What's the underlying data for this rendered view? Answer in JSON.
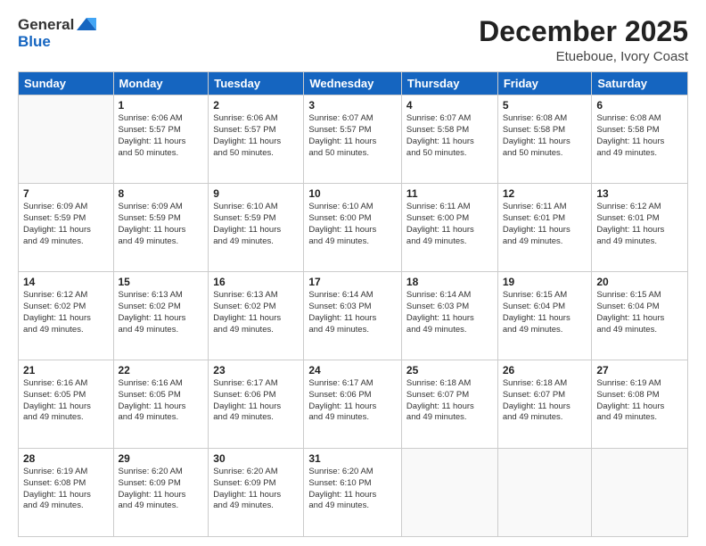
{
  "header": {
    "logo_line1": "General",
    "logo_line2": "Blue",
    "month_title": "December 2025",
    "location": "Etueboue, Ivory Coast"
  },
  "days_of_week": [
    "Sunday",
    "Monday",
    "Tuesday",
    "Wednesday",
    "Thursday",
    "Friday",
    "Saturday"
  ],
  "weeks": [
    [
      {
        "day": "",
        "info": ""
      },
      {
        "day": "1",
        "info": "Sunrise: 6:06 AM\nSunset: 5:57 PM\nDaylight: 11 hours\nand 50 minutes."
      },
      {
        "day": "2",
        "info": "Sunrise: 6:06 AM\nSunset: 5:57 PM\nDaylight: 11 hours\nand 50 minutes."
      },
      {
        "day": "3",
        "info": "Sunrise: 6:07 AM\nSunset: 5:57 PM\nDaylight: 11 hours\nand 50 minutes."
      },
      {
        "day": "4",
        "info": "Sunrise: 6:07 AM\nSunset: 5:58 PM\nDaylight: 11 hours\nand 50 minutes."
      },
      {
        "day": "5",
        "info": "Sunrise: 6:08 AM\nSunset: 5:58 PM\nDaylight: 11 hours\nand 50 minutes."
      },
      {
        "day": "6",
        "info": "Sunrise: 6:08 AM\nSunset: 5:58 PM\nDaylight: 11 hours\nand 49 minutes."
      }
    ],
    [
      {
        "day": "7",
        "info": "Sunrise: 6:09 AM\nSunset: 5:59 PM\nDaylight: 11 hours\nand 49 minutes."
      },
      {
        "day": "8",
        "info": "Sunrise: 6:09 AM\nSunset: 5:59 PM\nDaylight: 11 hours\nand 49 minutes."
      },
      {
        "day": "9",
        "info": "Sunrise: 6:10 AM\nSunset: 5:59 PM\nDaylight: 11 hours\nand 49 minutes."
      },
      {
        "day": "10",
        "info": "Sunrise: 6:10 AM\nSunset: 6:00 PM\nDaylight: 11 hours\nand 49 minutes."
      },
      {
        "day": "11",
        "info": "Sunrise: 6:11 AM\nSunset: 6:00 PM\nDaylight: 11 hours\nand 49 minutes."
      },
      {
        "day": "12",
        "info": "Sunrise: 6:11 AM\nSunset: 6:01 PM\nDaylight: 11 hours\nand 49 minutes."
      },
      {
        "day": "13",
        "info": "Sunrise: 6:12 AM\nSunset: 6:01 PM\nDaylight: 11 hours\nand 49 minutes."
      }
    ],
    [
      {
        "day": "14",
        "info": "Sunrise: 6:12 AM\nSunset: 6:02 PM\nDaylight: 11 hours\nand 49 minutes."
      },
      {
        "day": "15",
        "info": "Sunrise: 6:13 AM\nSunset: 6:02 PM\nDaylight: 11 hours\nand 49 minutes."
      },
      {
        "day": "16",
        "info": "Sunrise: 6:13 AM\nSunset: 6:02 PM\nDaylight: 11 hours\nand 49 minutes."
      },
      {
        "day": "17",
        "info": "Sunrise: 6:14 AM\nSunset: 6:03 PM\nDaylight: 11 hours\nand 49 minutes."
      },
      {
        "day": "18",
        "info": "Sunrise: 6:14 AM\nSunset: 6:03 PM\nDaylight: 11 hours\nand 49 minutes."
      },
      {
        "day": "19",
        "info": "Sunrise: 6:15 AM\nSunset: 6:04 PM\nDaylight: 11 hours\nand 49 minutes."
      },
      {
        "day": "20",
        "info": "Sunrise: 6:15 AM\nSunset: 6:04 PM\nDaylight: 11 hours\nand 49 minutes."
      }
    ],
    [
      {
        "day": "21",
        "info": "Sunrise: 6:16 AM\nSunset: 6:05 PM\nDaylight: 11 hours\nand 49 minutes."
      },
      {
        "day": "22",
        "info": "Sunrise: 6:16 AM\nSunset: 6:05 PM\nDaylight: 11 hours\nand 49 minutes."
      },
      {
        "day": "23",
        "info": "Sunrise: 6:17 AM\nSunset: 6:06 PM\nDaylight: 11 hours\nand 49 minutes."
      },
      {
        "day": "24",
        "info": "Sunrise: 6:17 AM\nSunset: 6:06 PM\nDaylight: 11 hours\nand 49 minutes."
      },
      {
        "day": "25",
        "info": "Sunrise: 6:18 AM\nSunset: 6:07 PM\nDaylight: 11 hours\nand 49 minutes."
      },
      {
        "day": "26",
        "info": "Sunrise: 6:18 AM\nSunset: 6:07 PM\nDaylight: 11 hours\nand 49 minutes."
      },
      {
        "day": "27",
        "info": "Sunrise: 6:19 AM\nSunset: 6:08 PM\nDaylight: 11 hours\nand 49 minutes."
      }
    ],
    [
      {
        "day": "28",
        "info": "Sunrise: 6:19 AM\nSunset: 6:08 PM\nDaylight: 11 hours\nand 49 minutes."
      },
      {
        "day": "29",
        "info": "Sunrise: 6:20 AM\nSunset: 6:09 PM\nDaylight: 11 hours\nand 49 minutes."
      },
      {
        "day": "30",
        "info": "Sunrise: 6:20 AM\nSunset: 6:09 PM\nDaylight: 11 hours\nand 49 minutes."
      },
      {
        "day": "31",
        "info": "Sunrise: 6:20 AM\nSunset: 6:10 PM\nDaylight: 11 hours\nand 49 minutes."
      },
      {
        "day": "",
        "info": ""
      },
      {
        "day": "",
        "info": ""
      },
      {
        "day": "",
        "info": ""
      }
    ]
  ]
}
